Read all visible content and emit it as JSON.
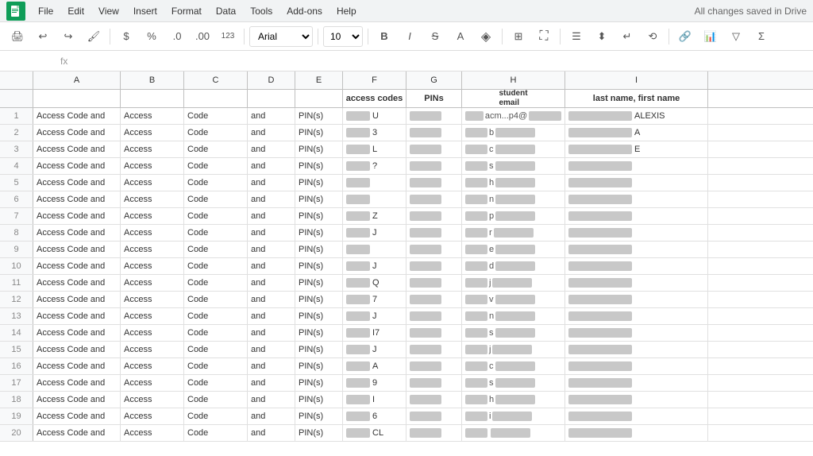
{
  "menubar": {
    "logo_char": "▦",
    "items": [
      "File",
      "Edit",
      "View",
      "Insert",
      "Format",
      "Data",
      "Tools",
      "Add-ons",
      "Help"
    ],
    "saved_status": "All changes saved in Drive"
  },
  "toolbar": {
    "font": "Arial",
    "font_size": "10",
    "buttons": [
      "print",
      "undo",
      "redo",
      "paint-format",
      "currency",
      "percent",
      "decimal-dec",
      "decimal-inc",
      "format-123",
      "bold",
      "italic",
      "strikethrough",
      "font-color",
      "fill-color",
      "borders",
      "merge",
      "align-left",
      "align-vert",
      "wrap",
      "rotate",
      "link",
      "chart",
      "filter",
      "functions"
    ]
  },
  "formula_bar": {
    "cell_ref": "",
    "fx": "fx"
  },
  "columns": {
    "letters": [
      "A",
      "B",
      "C",
      "D",
      "E",
      "F",
      "G",
      "H",
      "I"
    ],
    "sub_headers": {
      "f": "access codes",
      "g": "PINs",
      "h": "student\nemail",
      "i": "last name, first name"
    }
  },
  "rows": [
    {
      "num": 1,
      "a": "Access Code and",
      "b": "Access",
      "c": "Code",
      "d": "and",
      "e": "PIN(s)",
      "f": "U",
      "g_blur": true,
      "h_blur": true,
      "i_blur": true
    },
    {
      "num": 2,
      "a": "Access Code and",
      "b": "Access",
      "c": "Code",
      "d": "and",
      "e": "PIN(s)",
      "f": "3",
      "g_blur": true,
      "h_blur": true,
      "i_blur": true
    },
    {
      "num": 3,
      "a": "Access Code and",
      "b": "Access",
      "c": "Code",
      "d": "and",
      "e": "PIN(s)",
      "f": "L",
      "g_blur": true,
      "h_blur": true,
      "i_blur": true
    },
    {
      "num": 4,
      "a": "Access Code and",
      "b": "Access",
      "c": "Code",
      "d": "and",
      "e": "PIN(s)",
      "f": "?",
      "g_blur": true,
      "h_blur": true,
      "i_blur": true
    },
    {
      "num": 5,
      "a": "Access Code and",
      "b": "Access",
      "c": "Code",
      "d": "and",
      "e": "PIN(s)",
      "f": "",
      "g_blur": true,
      "h_blur": true,
      "i_blur": true
    },
    {
      "num": 6,
      "a": "Access Code and",
      "b": "Access",
      "c": "Code",
      "d": "and",
      "e": "PIN(s)",
      "f": "",
      "g_blur": true,
      "h_blur": true,
      "i_blur": true
    },
    {
      "num": 7,
      "a": "Access Code and",
      "b": "Access",
      "c": "Code",
      "d": "and",
      "e": "PIN(s)",
      "f": "Z",
      "g_blur": true,
      "h_blur": true,
      "i_blur": true
    },
    {
      "num": 8,
      "a": "Access Code and",
      "b": "Access",
      "c": "Code",
      "d": "and",
      "e": "PIN(s)",
      "f": "J",
      "g_blur": true,
      "h_blur": true,
      "i_blur": true
    },
    {
      "num": 9,
      "a": "Access Code and",
      "b": "Access",
      "c": "Code",
      "d": "and",
      "e": "PIN(s)",
      "f": "",
      "g_blur": true,
      "h_blur": true,
      "i_blur": true
    },
    {
      "num": 10,
      "a": "Access Code and",
      "b": "Access",
      "c": "Code",
      "d": "and",
      "e": "PIN(s)",
      "f": "J",
      "g_blur": true,
      "h_blur": true,
      "i_blur": true
    },
    {
      "num": 11,
      "a": "Access Code and",
      "b": "Access",
      "c": "Code",
      "d": "and",
      "e": "PIN(s)",
      "f": "Q",
      "g_blur": true,
      "h_blur": true,
      "i_blur": true
    },
    {
      "num": 12,
      "a": "Access Code and",
      "b": "Access",
      "c": "Code",
      "d": "and",
      "e": "PIN(s)",
      "f": "7",
      "g_blur": true,
      "h_blur": true,
      "i_blur": true
    },
    {
      "num": 13,
      "a": "Access Code and",
      "b": "Access",
      "c": "Code",
      "d": "and",
      "e": "PIN(s)",
      "f": "J",
      "g_blur": true,
      "h_blur": true,
      "i_blur": true
    },
    {
      "num": 14,
      "a": "Access Code and",
      "b": "Access",
      "c": "Code",
      "d": "and",
      "e": "PIN(s)",
      "f": "I7",
      "g_blur": true,
      "h_blur": true,
      "i_blur": true
    },
    {
      "num": 15,
      "a": "Access Code and",
      "b": "Access",
      "c": "Code",
      "d": "and",
      "e": "PIN(s)",
      "f": "J",
      "g_blur": true,
      "h_blur": true,
      "i_blur": true
    },
    {
      "num": 16,
      "a": "Access Code and",
      "b": "Access",
      "c": "Code",
      "d": "and",
      "e": "PIN(s)",
      "f": "A",
      "g_blur": true,
      "h_blur": true,
      "i_blur": true
    },
    {
      "num": 17,
      "a": "Access Code and",
      "b": "Access",
      "c": "Code",
      "d": "and",
      "e": "PIN(s)",
      "f": "9",
      "g_blur": true,
      "h_blur": true,
      "i_blur": true
    },
    {
      "num": 18,
      "a": "Access Code and",
      "b": "Access",
      "c": "Code",
      "d": "and",
      "e": "PIN(s)",
      "f": "I",
      "g_blur": true,
      "h_blur": true,
      "i_blur": true
    },
    {
      "num": 19,
      "a": "Access Code and",
      "b": "Access",
      "c": "Code",
      "d": "and",
      "e": "PIN(s)",
      "f": "6",
      "g_blur": true,
      "h_blur": true,
      "i_blur": true
    },
    {
      "num": 20,
      "a": "Access Code and",
      "b": "Access",
      "c": "Code",
      "d": "and",
      "e": "PIN(s)",
      "f": "CL",
      "g_blur": true,
      "h_blur": true,
      "i_blur": true
    }
  ]
}
